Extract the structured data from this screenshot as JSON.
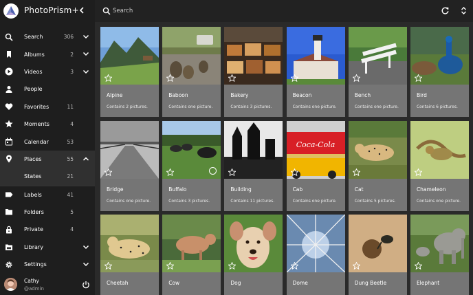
{
  "app": {
    "title": "PhotoPrism+"
  },
  "search": {
    "placeholder": "Search"
  },
  "nav": [
    {
      "label": "Search",
      "count": "306",
      "icon": "search-icon",
      "chevron": "down"
    },
    {
      "label": "Albums",
      "count": "2",
      "icon": "bookmark-icon",
      "chevron": "down"
    },
    {
      "label": "Videos",
      "count": "3",
      "icon": "play-icon",
      "chevron": "down"
    },
    {
      "label": "People",
      "count": "",
      "icon": "person-icon",
      "chevron": ""
    },
    {
      "label": "Favorites",
      "count": "11",
      "icon": "heart-icon",
      "chevron": ""
    },
    {
      "label": "Moments",
      "count": "4",
      "icon": "star-icon",
      "chevron": ""
    },
    {
      "label": "Calendar",
      "count": "53",
      "icon": "calendar-icon",
      "chevron": ""
    },
    {
      "label": "Places",
      "count": "55",
      "icon": "pin-icon",
      "chevron": "up"
    },
    {
      "label": "States",
      "count": "21",
      "icon": "",
      "chevron": ""
    },
    {
      "label": "Labels",
      "count": "41",
      "icon": "label-icon",
      "chevron": ""
    },
    {
      "label": "Folders",
      "count": "5",
      "icon": "folder-icon",
      "chevron": ""
    },
    {
      "label": "Private",
      "count": "4",
      "icon": "lock-icon",
      "chevron": ""
    },
    {
      "label": "Library",
      "count": "",
      "icon": "library-icon",
      "chevron": "down"
    },
    {
      "label": "Settings",
      "count": "",
      "icon": "gear-icon",
      "chevron": "down"
    }
  ],
  "user": {
    "name": "Cathy",
    "role": "@admin"
  },
  "labels": [
    {
      "title": "Alpine",
      "subtitle": "Contains 2 pictures."
    },
    {
      "title": "Baboon",
      "subtitle": "Contains one picture."
    },
    {
      "title": "Bakery",
      "subtitle": "Contains 3 pictures."
    },
    {
      "title": "Beacon",
      "subtitle": "Contains one picture."
    },
    {
      "title": "Bench",
      "subtitle": "Contains one picture."
    },
    {
      "title": "Bird",
      "subtitle": "Contains 6 pictures."
    },
    {
      "title": "Bridge",
      "subtitle": "Contains one picture."
    },
    {
      "title": "Buffalo",
      "subtitle": "Contains 3 pictures."
    },
    {
      "title": "Building",
      "subtitle": "Contains 11 pictures."
    },
    {
      "title": "Cab",
      "subtitle": "Contains one picture."
    },
    {
      "title": "Cat",
      "subtitle": "Contains 5 pictures."
    },
    {
      "title": "Chameleon",
      "subtitle": "Contains one picture."
    },
    {
      "title": "Cheetah",
      "subtitle": ""
    },
    {
      "title": "Cow",
      "subtitle": ""
    },
    {
      "title": "Dog",
      "subtitle": ""
    },
    {
      "title": "Dome",
      "subtitle": ""
    },
    {
      "title": "Dung Beetle",
      "subtitle": ""
    },
    {
      "title": "Elephant",
      "subtitle": ""
    }
  ],
  "sign_text": "Coca-Cola",
  "colors": {
    "sidebar": "#1e1e1e",
    "topbar": "#222222",
    "background": "#2a2a2a",
    "card": "#757575"
  }
}
